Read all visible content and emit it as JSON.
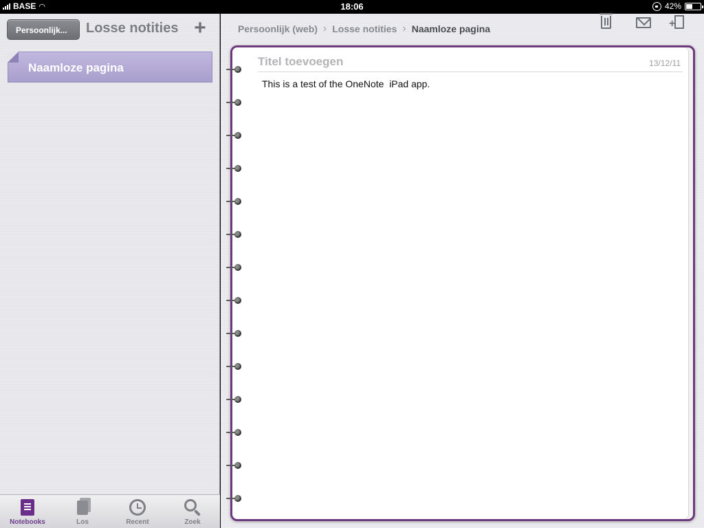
{
  "status_bar": {
    "carrier": "BASE",
    "time": "18:06",
    "battery": "42%"
  },
  "left_pane": {
    "back_label": "Persoonlijk...",
    "title": "Losse notities",
    "add_label": "+",
    "pages": [
      {
        "label": "Naamloze pagina"
      }
    ]
  },
  "tab_bar": {
    "tabs": [
      {
        "label": "Notebooks",
        "icon": "notebook-icon",
        "active": true
      },
      {
        "label": "Los",
        "icon": "pages-icon",
        "active": false
      },
      {
        "label": "Recent",
        "icon": "clock-icon",
        "active": false
      },
      {
        "label": "Zoek",
        "icon": "search-icon",
        "active": false
      }
    ]
  },
  "breadcrumb": {
    "items": [
      "Persoonlijk (web)",
      "Losse notities",
      "Naamloze pagina"
    ],
    "separator": "›"
  },
  "page": {
    "title_placeholder": "Titel toevoegen",
    "date": "13/12/11",
    "body": "This is a test of the OneNote  iPad app."
  },
  "colors": {
    "accent_purple": "#6c3a7c",
    "selected_item": "#b5acd6"
  }
}
